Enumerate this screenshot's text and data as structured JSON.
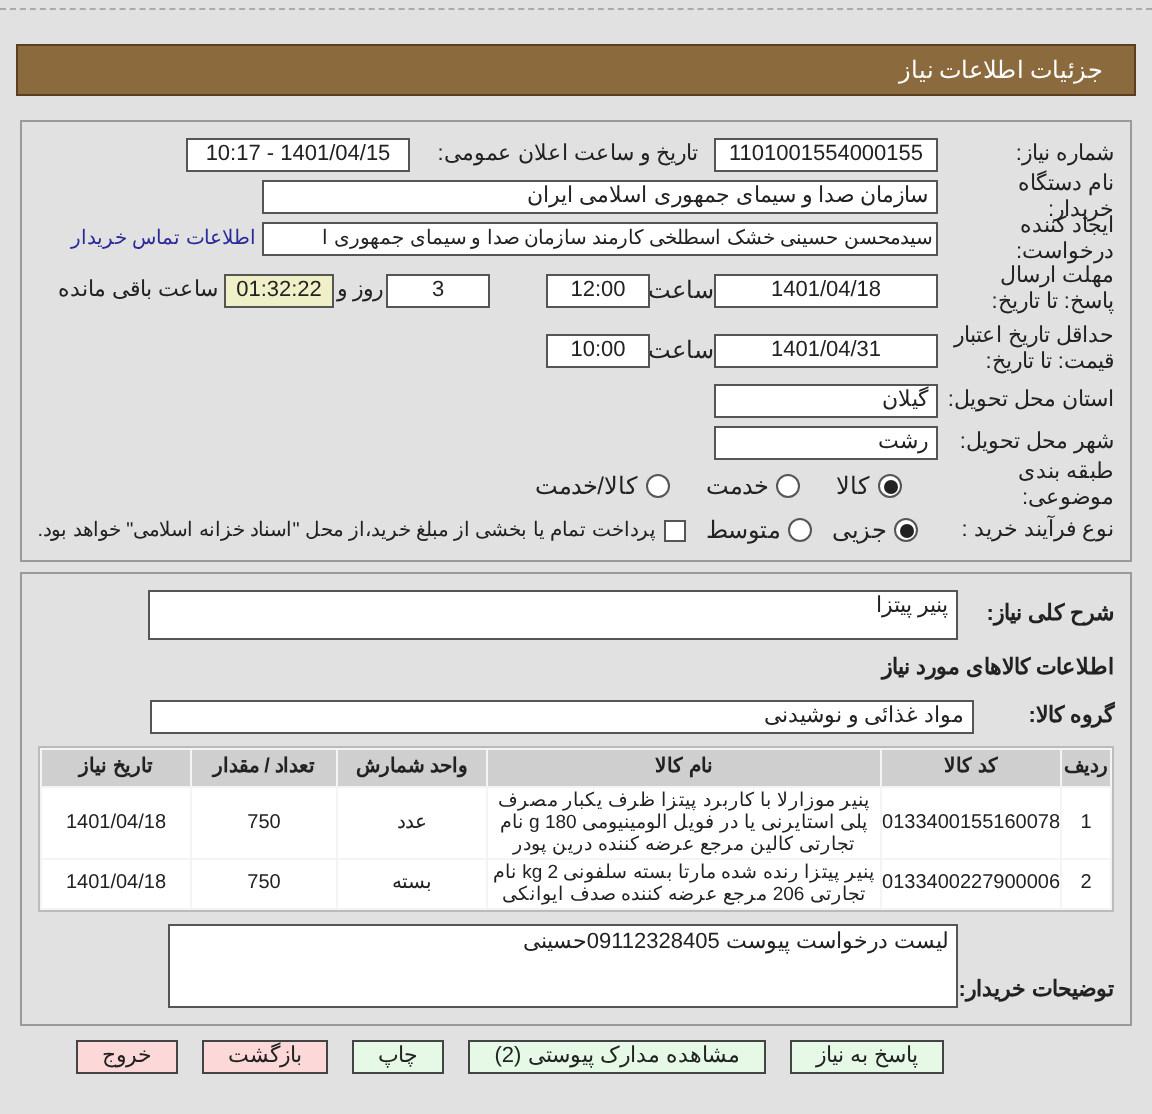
{
  "header": {
    "title": "جزئیات اطلاعات نیاز"
  },
  "details": {
    "need_number": {
      "label": "شماره نیاز:",
      "value": "1101001554000155"
    },
    "announce": {
      "label": "تاریخ و ساعت اعلان عمومی:",
      "value": "1401/04/15 - 10:17"
    },
    "buyer": {
      "label": "نام دستگاه خریدار:",
      "value": "سازمان صدا و سیمای جمهوری اسلامی ایران"
    },
    "creator": {
      "label": "ایجاد کننده درخواست:",
      "value": "سیدمحسن حسینی خشک اسطلخی کارمند سازمان صدا و سیمای جمهوری ا",
      "link": "اطلاعات تماس خریدار"
    },
    "deadline": {
      "label": "مهلت ارسال پاسخ: تا تاریخ:",
      "date": "1401/04/18",
      "time_label": "ساعت",
      "time": "12:00",
      "days": "3",
      "days_label": "روز و",
      "remaining": "01:32:22",
      "remaining_label": "ساعت باقی مانده"
    },
    "validity": {
      "label": "حداقل تاریخ اعتبار قیمت: تا تاریخ:",
      "date": "1401/04/31",
      "time_label": "ساعت",
      "time": "10:00"
    },
    "province": {
      "label": "استان محل تحویل:",
      "value": "گیلان"
    },
    "city": {
      "label": "شهر محل تحویل:",
      "value": "رشت"
    },
    "category": {
      "label": "طبقه بندی موضوعی:",
      "options": [
        {
          "label": "کالا",
          "selected": true
        },
        {
          "label": "خدمت",
          "selected": false
        },
        {
          "label": "کالا/خدمت",
          "selected": false
        }
      ]
    },
    "process": {
      "label": "نوع فرآیند خرید :",
      "options": [
        {
          "label": "جزیی",
          "selected": true
        },
        {
          "label": "متوسط",
          "selected": false
        }
      ],
      "treasury": {
        "label": "پرداخت تمام یا بخشی از مبلغ خرید،از محل \"اسناد خزانه اسلامی\" خواهد بود.",
        "checked": false
      }
    }
  },
  "goods": {
    "summary": {
      "label": "شرح کلی نیاز:",
      "value": "پنیر پیتزا"
    },
    "heading": "اطلاعات کالاهای مورد نیاز",
    "group": {
      "label": "گروه کالا:",
      "value": "مواد غذائی و نوشیدنی"
    },
    "table": {
      "columns": [
        "ردیف",
        "کد کالا",
        "نام کالا",
        "واحد شمارش",
        "تعداد / مقدار",
        "تاریخ نیاز"
      ],
      "rows": [
        [
          "1",
          "0133400155160078",
          "پنیر موزارلا با کاربرد پیتزا ظرف یکبار مصرف پلی استایرنی یا در فویل الومینیومی 180 g نام تجارتی کالین مرجع عرضه کننده درین پودر",
          "عدد",
          "750",
          "1401/04/18"
        ],
        [
          "2",
          "0133400227900006",
          "پنیر پیتزا رنده شده مارتا بسته سلفونی 2 kg نام تجارتی 206 مرجع عرضه کننده صدف ایوانکی",
          "بسته",
          "750",
          "1401/04/18"
        ]
      ]
    },
    "notes": {
      "label": "توضیحات خریدار:",
      "value": "لیست درخواست پیوست 09112328405حسینی"
    }
  },
  "buttons": [
    {
      "label": "پاسخ به نیاز",
      "kind": "action"
    },
    {
      "label": "مشاهده مدارک پیوستی (2)",
      "kind": "action"
    },
    {
      "label": "چاپ",
      "kind": "action"
    },
    {
      "label": "بازگشت",
      "kind": "exit"
    },
    {
      "label": "خروج",
      "kind": "exit"
    }
  ]
}
